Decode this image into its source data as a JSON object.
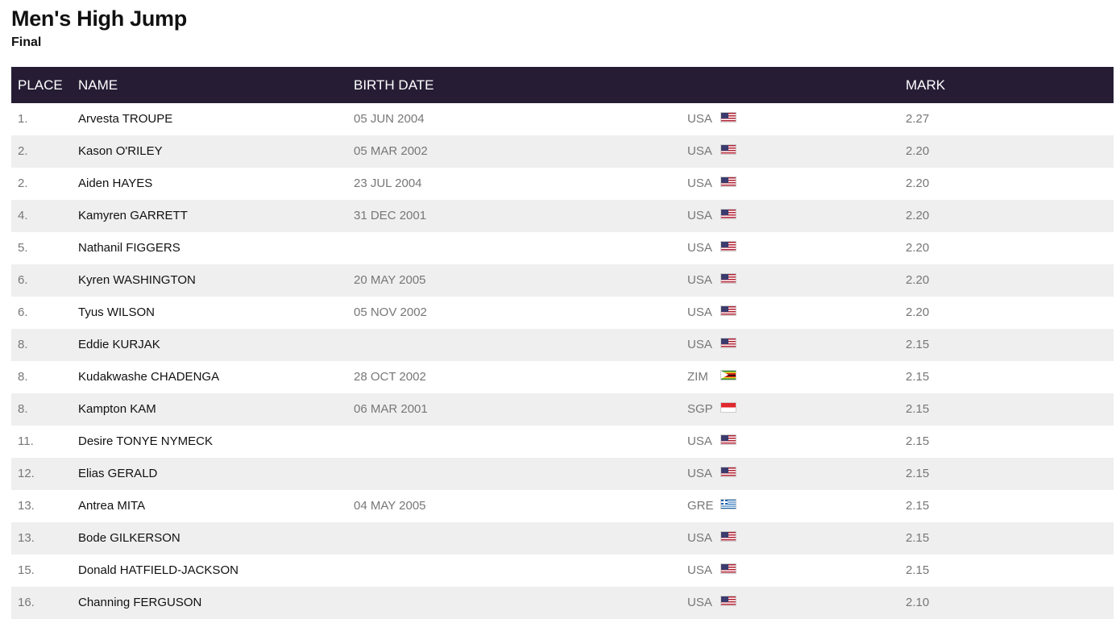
{
  "page": {
    "title": "Men's High Jump",
    "subtitle": "Final"
  },
  "table": {
    "headers": {
      "place": "PLACE",
      "name": "NAME",
      "birth_date": "BIRTH DATE",
      "country": "",
      "mark": "MARK"
    },
    "rows": [
      {
        "place": "1.",
        "name": "Arvesta TROUPE",
        "birth_date": "05 JUN 2004",
        "country": "USA",
        "flag": "usa-flag-icon",
        "mark": "2.27"
      },
      {
        "place": "2.",
        "name": "Kason O'RILEY",
        "birth_date": "05 MAR 2002",
        "country": "USA",
        "flag": "usa-flag-icon",
        "mark": "2.20"
      },
      {
        "place": "2.",
        "name": "Aiden HAYES",
        "birth_date": "23 JUL 2004",
        "country": "USA",
        "flag": "usa-flag-icon",
        "mark": "2.20"
      },
      {
        "place": "4.",
        "name": "Kamyren GARRETT",
        "birth_date": "31 DEC 2001",
        "country": "USA",
        "flag": "usa-flag-icon",
        "mark": "2.20"
      },
      {
        "place": "5.",
        "name": "Nathanil FIGGERS",
        "birth_date": "",
        "country": "USA",
        "flag": "usa-flag-icon",
        "mark": "2.20"
      },
      {
        "place": "6.",
        "name": "Kyren WASHINGTON",
        "birth_date": "20 MAY 2005",
        "country": "USA",
        "flag": "usa-flag-icon",
        "mark": "2.20"
      },
      {
        "place": "6.",
        "name": "Tyus WILSON",
        "birth_date": "05 NOV 2002",
        "country": "USA",
        "flag": "usa-flag-icon",
        "mark": "2.20"
      },
      {
        "place": "8.",
        "name": "Eddie KURJAK",
        "birth_date": "",
        "country": "USA",
        "flag": "usa-flag-icon",
        "mark": "2.15"
      },
      {
        "place": "8.",
        "name": "Kudakwashe CHADENGA",
        "birth_date": "28 OCT 2002",
        "country": "ZIM",
        "flag": "zim-flag-icon",
        "mark": "2.15"
      },
      {
        "place": "8.",
        "name": "Kampton KAM",
        "birth_date": "06 MAR 2001",
        "country": "SGP",
        "flag": "sgp-flag-icon",
        "mark": "2.15"
      },
      {
        "place": "11.",
        "name": "Desire TONYE NYMECK",
        "birth_date": "",
        "country": "USA",
        "flag": "usa-flag-icon",
        "mark": "2.15"
      },
      {
        "place": "12.",
        "name": "Elias GERALD",
        "birth_date": "",
        "country": "USA",
        "flag": "usa-flag-icon",
        "mark": "2.15"
      },
      {
        "place": "13.",
        "name": "Antrea MITA",
        "birth_date": "04 MAY 2005",
        "country": "GRE",
        "flag": "gre-flag-icon",
        "mark": "2.15"
      },
      {
        "place": "13.",
        "name": "Bode GILKERSON",
        "birth_date": "",
        "country": "USA",
        "flag": "usa-flag-icon",
        "mark": "2.15"
      },
      {
        "place": "15.",
        "name": "Donald HATFIELD-JACKSON",
        "birth_date": "",
        "country": "USA",
        "flag": "usa-flag-icon",
        "mark": "2.15"
      },
      {
        "place": "16.",
        "name": "Channing FERGUSON",
        "birth_date": "",
        "country": "USA",
        "flag": "usa-flag-icon",
        "mark": "2.10"
      }
    ]
  },
  "colors": {
    "header_bg": "#261d35",
    "header_text": "#ffffff",
    "row_alt_bg": "#efefef",
    "muted_text": "#777777"
  }
}
